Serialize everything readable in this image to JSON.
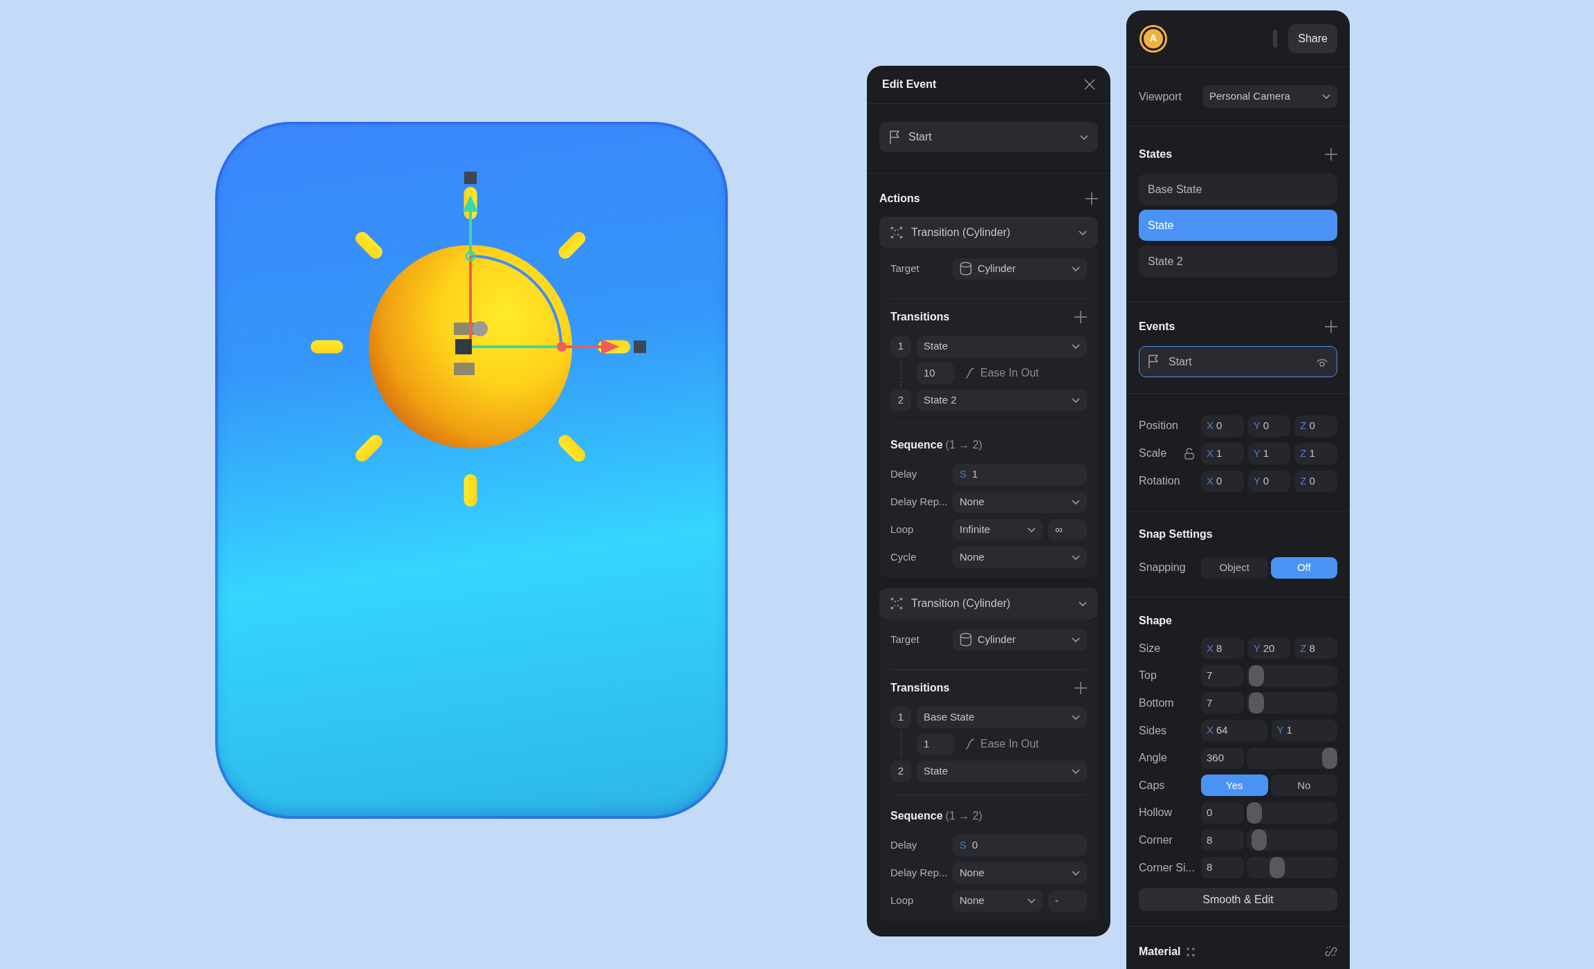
{
  "edit_event": {
    "title": "Edit Event",
    "trigger": "Start",
    "actions_title": "Actions",
    "actions": [
      {
        "title": "Transition (Cylinder)",
        "target_label": "Target",
        "target": "Cylinder",
        "transitions_title": "Transitions",
        "transitions": [
          {
            "number": "1",
            "state": "State"
          },
          {
            "number": "2",
            "state": "State 2"
          }
        ],
        "duration": "10",
        "easing": "Ease In Out",
        "sequence_title": "Sequence",
        "sequence_range": "(1 → 2)",
        "fields": [
          {
            "kind": "input",
            "label": "Delay",
            "prefix": "S",
            "value": "1"
          },
          {
            "kind": "select",
            "label": "Delay Rep...",
            "value": "None"
          },
          {
            "kind": "loop",
            "label": "Loop",
            "value": "Infinite",
            "extra": "∞"
          },
          {
            "kind": "select",
            "label": "Cycle",
            "value": "None"
          }
        ]
      },
      {
        "title": "Transition (Cylinder)",
        "target_label": "Target",
        "target": "Cylinder",
        "transitions_title": "Transitions",
        "transitions": [
          {
            "number": "1",
            "state": "Base State"
          },
          {
            "number": "2",
            "state": "State"
          }
        ],
        "duration": "1",
        "easing": "Ease In Out",
        "sequence_title": "Sequence",
        "sequence_range": "(1 → 2)",
        "fields": [
          {
            "kind": "input",
            "label": "Delay",
            "prefix": "S",
            "value": "0"
          },
          {
            "kind": "select",
            "label": "Delay Rep...",
            "value": "None"
          },
          {
            "kind": "loop",
            "label": "Loop",
            "value": "None",
            "extra": "-"
          }
        ]
      }
    ]
  },
  "properties": {
    "avatar": "A",
    "share": "Share",
    "viewport_label": "Viewport",
    "viewport": "Personal Camera",
    "states_title": "States",
    "states": [
      {
        "label": "Base State",
        "selected": false
      },
      {
        "label": "State",
        "selected": true
      },
      {
        "label": "State 2",
        "selected": false
      }
    ],
    "events_title": "Events",
    "events": [
      {
        "label": "Start",
        "selected": true
      }
    ],
    "transform": [
      {
        "label": "Position",
        "lock_icon": false,
        "fields": [
          {
            "axis": "X",
            "value": "0"
          },
          {
            "axis": "Y",
            "value": "0"
          },
          {
            "axis": "Z",
            "value": "0"
          }
        ]
      },
      {
        "label": "Scale",
        "lock_icon": true,
        "fields": [
          {
            "axis": "X",
            "value": "1"
          },
          {
            "axis": "Y",
            "value": "1"
          },
          {
            "axis": "Z",
            "value": "1"
          }
        ]
      },
      {
        "label": "Rotation",
        "lock_icon": false,
        "fields": [
          {
            "axis": "X",
            "value": "0"
          },
          {
            "axis": "Y",
            "value": "0"
          },
          {
            "axis": "Z",
            "value": "0"
          }
        ]
      }
    ],
    "snap_title": "Snap Settings",
    "snap_label": "Snapping",
    "snap_options": [
      {
        "label": "Object",
        "selected": false
      },
      {
        "label": "Off",
        "selected": true
      }
    ],
    "shape_title": "Shape",
    "shape_rows": [
      {
        "kind": "axes",
        "label": "Size",
        "fields": [
          {
            "axis": "X",
            "value": "8"
          },
          {
            "axis": "Y",
            "value": "20"
          },
          {
            "axis": "Z",
            "value": "8"
          }
        ]
      },
      {
        "kind": "slider",
        "label": "Top",
        "value": "7",
        "level": 0.03
      },
      {
        "kind": "slider",
        "label": "Bottom",
        "value": "7",
        "level": 0.03
      },
      {
        "kind": "axes",
        "label": "Sides",
        "fields": [
          {
            "axis": "X",
            "value": "64"
          },
          {
            "axis": "Y",
            "value": "1"
          }
        ]
      },
      {
        "kind": "slider",
        "label": "Angle",
        "value": "360",
        "level": 1
      },
      {
        "kind": "toggle",
        "label": "Caps",
        "options": [
          {
            "label": "Yes",
            "selected": true
          },
          {
            "label": "No",
            "selected": false
          }
        ]
      },
      {
        "kind": "slider",
        "label": "Hollow",
        "value": "0",
        "level": 0
      },
      {
        "kind": "slider",
        "label": "Corner",
        "value": "8",
        "level": 0.06
      },
      {
        "kind": "slider",
        "label": "Corner Si...",
        "value": "8",
        "level": 0.3
      }
    ],
    "smooth_button": "Smooth & Edit",
    "material_title": "Material"
  }
}
